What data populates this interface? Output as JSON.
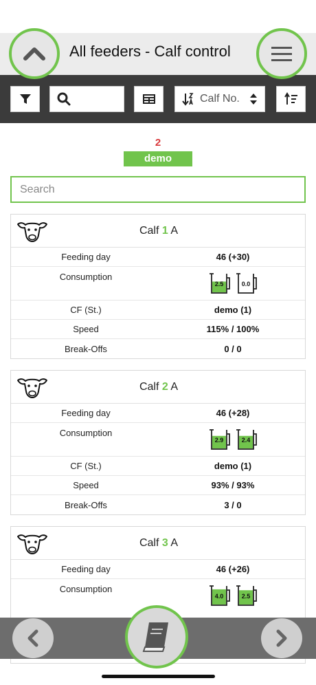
{
  "header": {
    "title": "All feeders - Calf control"
  },
  "toolbar": {
    "search_value": "",
    "sort_label": "Calf No."
  },
  "feeder": {
    "count": "2",
    "name": "demo"
  },
  "search": {
    "placeholder": "Search"
  },
  "labels": {
    "feeding_day": "Feeding day",
    "consumption": "Consumption",
    "cf": "CF (St.)",
    "speed": "Speed",
    "breakoffs": "Break-Offs"
  },
  "calves": [
    {
      "prefix": "Calf",
      "number": "1",
      "group": "A",
      "feeding_day": "46 (+30)",
      "consumption": [
        "2.5",
        "0.0"
      ],
      "consumption_fill": [
        0.6,
        0.0
      ],
      "cf": "demo (1)",
      "speed": "115% / 100%",
      "breakoffs": "0 / 0"
    },
    {
      "prefix": "Calf",
      "number": "2",
      "group": "A",
      "feeding_day": "46 (+28)",
      "consumption": [
        "2.9",
        "2.4"
      ],
      "consumption_fill": [
        0.7,
        0.7
      ],
      "cf": "demo (1)",
      "speed": "93% / 93%",
      "breakoffs": "3 / 0"
    },
    {
      "prefix": "Calf",
      "number": "3",
      "group": "A",
      "feeding_day": "46 (+26)",
      "consumption": [
        "4.0",
        "2.5"
      ],
      "consumption_fill": [
        0.85,
        0.8
      ]
    }
  ],
  "colors": {
    "accent": "#71c44c",
    "count": "#d9373a",
    "toolbar": "#3b3b3b",
    "water": "#3aa0d8"
  }
}
